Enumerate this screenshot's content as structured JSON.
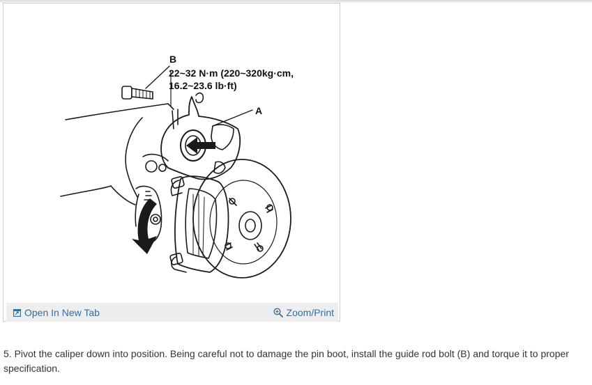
{
  "figure": {
    "callout_b": "B",
    "torque_line1": "22~32 N·m (220~320kg·cm,",
    "torque_line2": "16.2~23.6 lb·ft)",
    "callout_a": "A"
  },
  "toolbar": {
    "open_tab_label": "Open In New Tab",
    "open_tab_icon": "open-new-tab-icon",
    "zoom_label": "Zoom/Print",
    "zoom_icon": "zoom-magnifier-icon"
  },
  "instruction": {
    "text": "5. Pivot the caliper down into position. Being careful not to damage the pin boot, install the guide rod bolt (B) and torque it to proper specification."
  },
  "colors": {
    "link": "#2e6fa8",
    "toolbar_bg": "#eeeeee",
    "body_text": "#333333"
  }
}
